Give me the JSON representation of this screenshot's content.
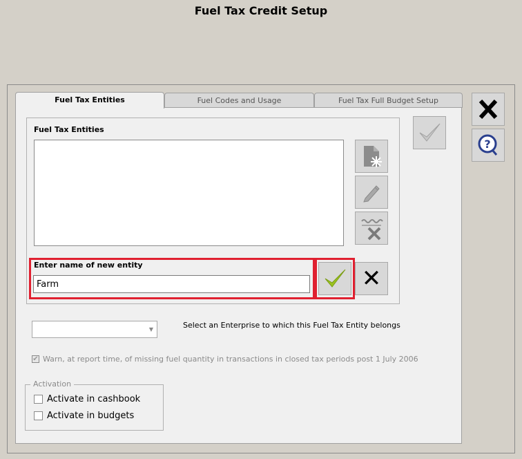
{
  "window": {
    "title": "Fuel Tax Credit Setup"
  },
  "tabs": [
    {
      "label": "Fuel Tax Entities",
      "active": true
    },
    {
      "label": "Fuel Codes and Usage",
      "active": false
    },
    {
      "label": "Fuel Tax Full Budget Setup",
      "active": false
    }
  ],
  "entities": {
    "group_label": "Fuel Tax Entities",
    "items": []
  },
  "new_entity": {
    "label": "Enter name of new entity",
    "value": "Farm"
  },
  "enterprise": {
    "selected": "",
    "label": "Select an Enterprise to which this Fuel Tax Entity belongs"
  },
  "warning": {
    "label": "Warn, at report time, of missing fuel quantity in transactions in closed tax periods post 1 July 2006",
    "checked": true,
    "enabled": false
  },
  "activation": {
    "legend": "Activation",
    "cashbook_label": "Activate in cashbook",
    "budgets_label": "Activate in budgets"
  },
  "colors": {
    "highlight": "#e02030",
    "check_green": "#9bc31f"
  },
  "icons": {
    "add": "new-document-icon",
    "edit": "pencil-icon",
    "delete": "delete-icon",
    "confirm": "checkmark-icon",
    "cancel": "x-icon",
    "close": "close-icon",
    "help": "help-icon"
  }
}
